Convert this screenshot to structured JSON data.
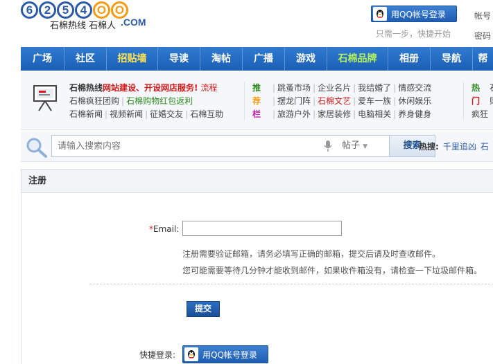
{
  "header": {
    "logo_digits": [
      "6",
      "2",
      "5",
      "4",
      "O",
      "O"
    ],
    "logo_com": ".COM",
    "logo_tagline": "石棉热线 石棉人",
    "qq_login_label": "用QQ帐号登录",
    "qq_login_hint": "只需一步，快捷开始",
    "account_label": "帐号",
    "password_label": "密码"
  },
  "nav": {
    "items": [
      {
        "label": "广场",
        "color": "#ffffff"
      },
      {
        "label": "社区",
        "color": "#ffffff"
      },
      {
        "label": "招贴墙",
        "color": "#ffe34d"
      },
      {
        "label": "导读",
        "color": "#ffffff"
      },
      {
        "label": "淘帖",
        "color": "#ffffff"
      },
      {
        "label": "广播",
        "color": "#ffffff"
      },
      {
        "label": "游戏",
        "color": "#ffffff"
      },
      {
        "label": "石棉品牌",
        "color": "#b7f35a"
      },
      {
        "label": "相册",
        "color": "#ffffff"
      },
      {
        "label": "导航",
        "color": "#ffffff"
      },
      {
        "label": "帮",
        "color": "#ffffff"
      }
    ]
  },
  "promo": {
    "line1_a": "石棉热线",
    "line1_b": "网站建设、开设网店服务!",
    "line1_c": "流程",
    "line2": [
      "石棉疯狂团购",
      "石棉购物红包返利"
    ],
    "line3": [
      "石棉新闻",
      "视频新闻",
      "征婚交友",
      "石棉互助"
    ],
    "rec_chars": [
      "推",
      "荐",
      "栏"
    ],
    "rec_rows": [
      [
        "跳蚤市场",
        "企业名片",
        "我结婚了",
        "情感交流"
      ],
      [
        "摆龙门阵",
        "石棉文艺",
        "爱车一族",
        "休闲娱乐"
      ],
      [
        "旅游户外",
        "家居装修",
        "电脑相关",
        "养身健身"
      ]
    ],
    "hot_chars": [
      "热",
      "门"
    ],
    "hot_rows": [
      "石",
      "则",
      "疯狂"
    ]
  },
  "search": {
    "placeholder": "请输入搜索内容",
    "scope": "帖子",
    "button": "搜索",
    "hot_label": "热搜:",
    "hot_items": [
      "千里追凶",
      "石"
    ]
  },
  "register": {
    "title": "注册",
    "email_label": "Email:",
    "email_value": "",
    "hint1": "注册需要验证邮箱，请务必填写正确的邮箱，提交后请及时查收邮件。",
    "hint2": "您可能需要等待几分钟才能收到邮件，如果收件箱没有，请检查一下垃圾邮件箱。",
    "submit": "提交",
    "quick_label": "快捷登录:",
    "qq_login_label": "用QQ帐号登录"
  },
  "colors": {
    "nav_blue": "#1f66bf",
    "accent_red": "#d61a1a",
    "link_green": "#2f8a22",
    "logo_blue": "#2b5aa8",
    "logo_orange": "#f39c12"
  }
}
